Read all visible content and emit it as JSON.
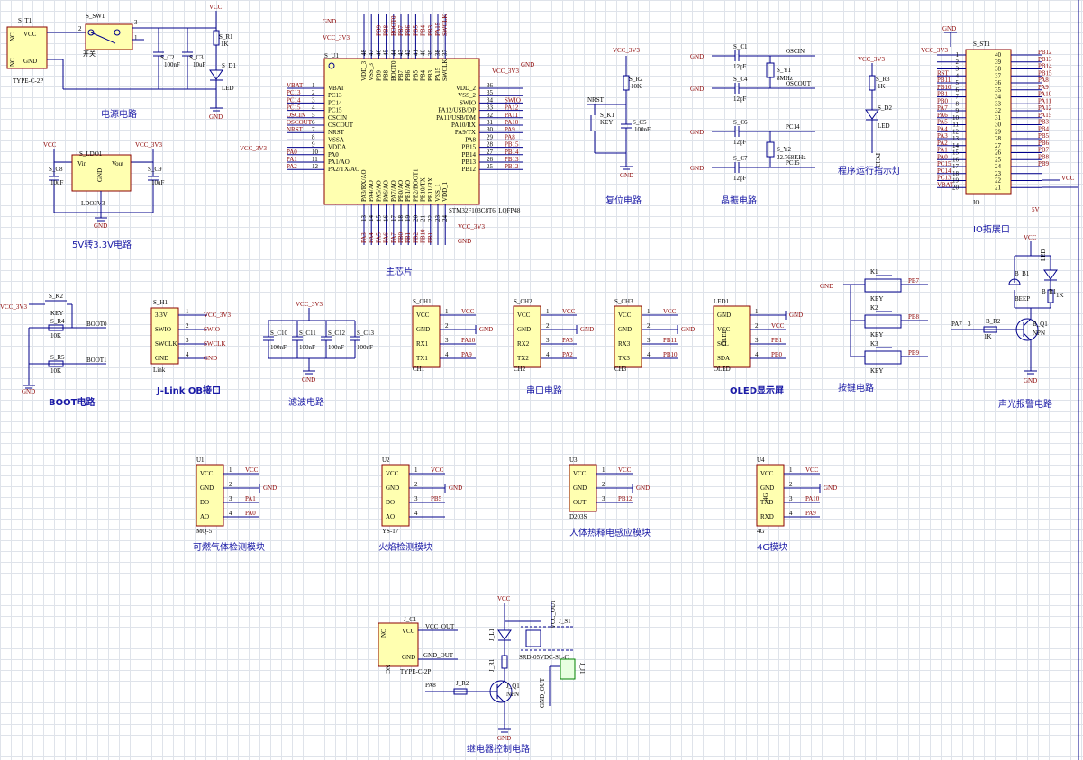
{
  "sections": {
    "power": "电源电路",
    "ldo": "5V转3.3V电路",
    "mcu": "主芯片",
    "reset": "复位电路",
    "crystal": "晶振电路",
    "indicator": "程序运行指示灯",
    "io": "IO拓展口",
    "boot": "BOOT电路",
    "jlink": "J-Link OB接口",
    "filter": "滤波电路",
    "uart": "串口电路",
    "oled": "OLED显示屏",
    "keys": "按键电路",
    "alarm": "声光报警电路",
    "gas": "可燃气体检测模块",
    "flame": "火焰检测模块",
    "pir": "人体热释电感应模块",
    "m4g": "4G模块",
    "relay": "继电器控制电路"
  },
  "power": {
    "usb_ref": "S_T1",
    "usb_name": "TYPE-C-2P",
    "nc": "NC",
    "vcc": "VCC",
    "gnd": "GND",
    "sw_ref": "S_SW1",
    "sw_name": "开关",
    "c2": "S_C2",
    "c2v": "100nF",
    "c3": "S_C3",
    "c3v": "10uF",
    "r1": "S_R1",
    "r1v": "1K",
    "d1": "S_D1",
    "led": "LED",
    "vcc_net": "VCC",
    "gnd_net": "GND",
    "p1": "1",
    "p2": "2",
    "p3": "3"
  },
  "ldo": {
    "ref": "S_LDO1",
    "vin": "Vin",
    "vout": "Vout",
    "gnd": "GND",
    "name": "LDO3V3",
    "c8": "S_C8",
    "c9": "S_C9",
    "cv": "10uF",
    "vcc": "VCC",
    "vcc33": "VCC_3V3",
    "gnd_net": "GND"
  },
  "mcu": {
    "ref": "S_U1",
    "part": "STM32F103C8T6_LQFP48",
    "left_pins": [
      {
        "num": "1",
        "name": "VBAT",
        "net": "VBAT"
      },
      {
        "num": "2",
        "name": "PC13",
        "net": "PC13"
      },
      {
        "num": "3",
        "name": "PC14",
        "net": "PC14"
      },
      {
        "num": "4",
        "name": "PC15",
        "net": "PC15"
      },
      {
        "num": "5",
        "name": "OSCIN",
        "net": "OSCIN"
      },
      {
        "num": "6",
        "name": "OSCOUT",
        "net": "OSCOUT"
      },
      {
        "num": "7",
        "name": "NRST",
        "net": "NRST"
      },
      {
        "num": "8",
        "name": "VSSA",
        "net": "GND"
      },
      {
        "num": "9",
        "name": "VDDA",
        "net": "VCC_3V3"
      },
      {
        "num": "10",
        "name": "PA0",
        "net": "PA0"
      },
      {
        "num": "11",
        "name": "PA1/AO",
        "net": "PA1"
      },
      {
        "num": "12",
        "name": "PA2/TX/AO",
        "net": "PA2"
      }
    ],
    "right_pins": [
      {
        "num": "36",
        "name": "VDD_2",
        "net": ""
      },
      {
        "num": "35",
        "name": "VSS_2",
        "net": ""
      },
      {
        "num": "34",
        "name": "SWIO",
        "net": "SWIO"
      },
      {
        "num": "33",
        "name": "PA12/USB/DP",
        "net": "PA12"
      },
      {
        "num": "32",
        "name": "PA11/USB/DM",
        "net": "PA11"
      },
      {
        "num": "31",
        "name": "PA10/RX",
        "net": "PA10"
      },
      {
        "num": "30",
        "name": "PA9/TX",
        "net": "PA9"
      },
      {
        "num": "29",
        "name": "PA8",
        "net": "PA8"
      },
      {
        "num": "28",
        "name": "PB15",
        "net": "PB15"
      },
      {
        "num": "27",
        "name": "PB14",
        "net": "PB14"
      },
      {
        "num": "26",
        "name": "PB13",
        "net": "PB13"
      },
      {
        "num": "25",
        "name": "PB12",
        "net": "PB12"
      }
    ],
    "top_pins": [
      {
        "num": "48",
        "name": "VDD_3"
      },
      {
        "num": "47",
        "name": "VSS_3"
      },
      {
        "num": "46",
        "name": "PB9"
      },
      {
        "num": "45",
        "name": "PB8"
      },
      {
        "num": "44",
        "name": "BOOT0"
      },
      {
        "num": "43",
        "name": "PB7"
      },
      {
        "num": "42",
        "name": "PB6"
      },
      {
        "num": "41",
        "name": "PB5"
      },
      {
        "num": "40",
        "name": "PB4"
      },
      {
        "num": "39",
        "name": "PB3"
      },
      {
        "num": "38",
        "name": "PA15"
      },
      {
        "num": "37",
        "name": "SWCLK"
      }
    ],
    "bottom_pins": [
      {
        "num": "13",
        "name": "PA3/RX/AO"
      },
      {
        "num": "14",
        "name": "PA4/AO"
      },
      {
        "num": "15",
        "name": "PA5/AO"
      },
      {
        "num": "16",
        "name": "PA6/AO"
      },
      {
        "num": "17",
        "name": "PA7/AO"
      },
      {
        "num": "18",
        "name": "PB0/AO"
      },
      {
        "num": "19",
        "name": "PB1/AO"
      },
      {
        "num": "20",
        "name": "PB2/BOOT1"
      },
      {
        "num": "21",
        "name": "PB10/TX"
      },
      {
        "num": "22",
        "name": "PB11/RX"
      },
      {
        "num": "23",
        "name": "VSS_1"
      },
      {
        "num": "24",
        "name": "VDD_1"
      }
    ],
    "top_nets": [
      "",
      "",
      "PB9",
      "PB8",
      "BOOT0",
      "PB7",
      "PB6",
      "PB5",
      "PB4",
      "PB3",
      "PA15",
      "SWCLK"
    ],
    "bottom_nets": [
      "PA3",
      "PA4",
      "PA5",
      "PA6",
      "PA7",
      "PB0",
      "PB1",
      "PB2",
      "PB10",
      "PB11",
      "",
      ""
    ],
    "gnd": "GND",
    "vcc33": "VCC_3V3"
  },
  "reset": {
    "vcc33": "VCC_3V3",
    "r2": "S_R2",
    "r2v": "10K",
    "nrst": "NRST",
    "k1": "S_K1",
    "key": "KEY",
    "c5": "S_C5",
    "c5v": "100nF",
    "gnd": "GND"
  },
  "crystal": {
    "c1": "S_C1",
    "c4": "S_C4",
    "c6": "S_C6",
    "c7": "S_C7",
    "cv": "12pF",
    "y1": "S_Y1",
    "y1f": "8MHz",
    "y2": "S_Y2",
    "y2f": "32.768KHz",
    "oscin": "OSCIN",
    "oscout": "OSCOUT",
    "pc14": "PC14",
    "pc15": "PC15",
    "gnd": "GND"
  },
  "indicator": {
    "vcc33": "VCC_3V3",
    "r3": "S_R3",
    "r3v": "1K",
    "d2": "S_D2",
    "led": "LED",
    "net": "PC13"
  },
  "io": {
    "ref": "S_ST1",
    "name": "IO",
    "gnd": "GND",
    "vcc33": "VCC_3V3",
    "vcc": "VCC",
    "v5": "5V",
    "left": [
      {
        "net": "",
        "num": "1"
      },
      {
        "net": "",
        "num": "2"
      },
      {
        "net": "",
        "num": "3"
      },
      {
        "net": "RST",
        "num": "4"
      },
      {
        "net": "PB11",
        "num": "5"
      },
      {
        "net": "PB10",
        "num": "6"
      },
      {
        "net": "PB1",
        "num": "7"
      },
      {
        "net": "PB0",
        "num": "8"
      },
      {
        "net": "PA7",
        "num": "9"
      },
      {
        "net": "PA6",
        "num": "10"
      },
      {
        "net": "PA5",
        "num": "11"
      },
      {
        "net": "PA4",
        "num": "12"
      },
      {
        "net": "PA3",
        "num": "13"
      },
      {
        "net": "PA2",
        "num": "14"
      },
      {
        "net": "PA1",
        "num": "15"
      },
      {
        "net": "PA0",
        "num": "16"
      },
      {
        "net": "PC15",
        "num": "17"
      },
      {
        "net": "PC14",
        "num": "18"
      },
      {
        "net": "PC13",
        "num": "19"
      },
      {
        "net": "VBAT",
        "num": "20"
      }
    ],
    "right": [
      {
        "num": "40",
        "net": "PB12"
      },
      {
        "num": "39",
        "net": "PB13"
      },
      {
        "num": "38",
        "net": "PB14"
      },
      {
        "num": "37",
        "net": "PB15"
      },
      {
        "num": "36",
        "net": "PA8"
      },
      {
        "num": "35",
        "net": "PA9"
      },
      {
        "num": "34",
        "net": "PA10"
      },
      {
        "num": "33",
        "net": "PA11"
      },
      {
        "num": "32",
        "net": "PA12"
      },
      {
        "num": "31",
        "net": "PA15"
      },
      {
        "num": "30",
        "net": "PB3"
      },
      {
        "num": "29",
        "net": "PB4"
      },
      {
        "num": "28",
        "net": "PB5"
      },
      {
        "num": "27",
        "net": "PB6"
      },
      {
        "num": "26",
        "net": "PB7"
      },
      {
        "num": "25",
        "net": "PB8"
      },
      {
        "num": "24",
        "net": "PB9"
      },
      {
        "num": "23",
        "net": ""
      },
      {
        "num": "22",
        "net": ""
      },
      {
        "num": "21",
        "net": ""
      }
    ]
  },
  "boot": {
    "vcc33": "VCC_3V3",
    "k2": "S_K2",
    "key": "KEY",
    "r4": "S_R4",
    "r5": "S_R5",
    "rv": "10K",
    "boot0": "BOOT0",
    "boot1": "BOOT1",
    "gnd": "GND"
  },
  "jlink": {
    "ref": "S_H1",
    "name": "Link",
    "pins": [
      {
        "num": "1",
        "name": "3.3V",
        "net": "VCC_3V3"
      },
      {
        "num": "2",
        "name": "SWIO",
        "net": "SWIO"
      },
      {
        "num": "3",
        "name": "SWCLK",
        "net": "SWCLK"
      },
      {
        "num": "4",
        "name": "GND",
        "net": "GND"
      }
    ]
  },
  "filter": {
    "vcc33": "VCC_3V3",
    "caps": [
      "S_C10",
      "S_C11",
      "S_C12",
      "S_C13"
    ],
    "cv": "100nF",
    "gnd": "GND"
  },
  "uart": [
    {
      "ref": "S_CH1",
      "name": "CH1",
      "pins": [
        {
          "num": "1",
          "name": "VCC",
          "net": "VCC"
        },
        {
          "num": "2",
          "name": "GND",
          "net": "GND"
        },
        {
          "num": "3",
          "name": "RX1",
          "net": "PA10"
        },
        {
          "num": "4",
          "name": "TX1",
          "net": "PA9"
        }
      ]
    },
    {
      "ref": "S_CH2",
      "name": "CH2",
      "pins": [
        {
          "num": "1",
          "name": "VCC",
          "net": "VCC"
        },
        {
          "num": "2",
          "name": "GND",
          "net": "GND"
        },
        {
          "num": "3",
          "name": "RX2",
          "net": "PA3"
        },
        {
          "num": "4",
          "name": "TX2",
          "net": "PA2"
        }
      ]
    },
    {
      "ref": "S_CH3",
      "name": "CH3",
      "pins": [
        {
          "num": "1",
          "name": "VCC",
          "net": "VCC"
        },
        {
          "num": "2",
          "name": "GND",
          "net": "GND"
        },
        {
          "num": "3",
          "name": "RX3",
          "net": "PB11"
        },
        {
          "num": "4",
          "name": "TX3",
          "net": "PB10"
        }
      ]
    }
  ],
  "oled": {
    "ref": "LED1",
    "name": "OLED",
    "side": "OLED",
    "pins": [
      {
        "num": "1",
        "name": "GND",
        "net": "GND"
      },
      {
        "num": "2",
        "name": "VCC",
        "net": "VCC"
      },
      {
        "num": "3",
        "name": "SCL",
        "net": "PB1"
      },
      {
        "num": "4",
        "name": "SDA",
        "net": "PB0"
      }
    ]
  },
  "keys": {
    "gnd": "GND",
    "items": [
      {
        "ref": "K1",
        "name": "KEY",
        "net": "PB7"
      },
      {
        "ref": "K2",
        "name": "KEY",
        "net": "PB8"
      },
      {
        "ref": "K3",
        "name": "KEY",
        "net": "PB9"
      }
    ]
  },
  "alarm": {
    "vcc": "VCC",
    "b1": "B_B1",
    "beep": "BEEP",
    "b_r1": "B_R1",
    "r1v": "1K",
    "led": "LED",
    "pa7": "PA7",
    "r2": "B_R2",
    "r2v": "1K",
    "q1": "B_Q1",
    "npn": "NPN",
    "gnd": "GND",
    "p3": "3"
  },
  "modules": [
    {
      "ref": "U1",
      "name": "MQ-5",
      "pins": [
        {
          "num": "1",
          "name": "VCC",
          "net": "VCC"
        },
        {
          "num": "2",
          "name": "GND",
          "net": "GND"
        },
        {
          "num": "3",
          "name": "DO",
          "net": "PA1"
        },
        {
          "num": "4",
          "name": "AO",
          "net": "PA0"
        }
      ]
    },
    {
      "ref": "U2",
      "name": "YS-17",
      "pins": [
        {
          "num": "1",
          "name": "VCC",
          "net": "VCC"
        },
        {
          "num": "2",
          "name": "GND",
          "net": "GND"
        },
        {
          "num": "3",
          "name": "DO",
          "net": "PB5"
        },
        {
          "num": "4",
          "name": "AO",
          "net": ""
        }
      ]
    },
    {
      "ref": "U3",
      "name": "D203S",
      "pins": [
        {
          "num": "1",
          "name": "VCC",
          "net": "VCC"
        },
        {
          "num": "2",
          "name": "GND",
          "net": "GND"
        },
        {
          "num": "3",
          "name": "OUT",
          "net": "PB12"
        }
      ]
    },
    {
      "ref": "U4",
      "name": "4G",
      "side": "4G",
      "pins": [
        {
          "num": "1",
          "name": "VCC",
          "net": "VCC"
        },
        {
          "num": "2",
          "name": "GND",
          "net": "GND"
        },
        {
          "num": "3",
          "name": "TXD",
          "net": "PA10"
        },
        {
          "num": "4",
          "name": "RXD",
          "net": "PA9"
        }
      ]
    }
  ],
  "relay": {
    "jc1": "J_C1",
    "usb": "TYPE-C-2P",
    "nc": "NC",
    "vcc": "VCC",
    "gnd": "GND",
    "vcc_out": "VCC_OUT",
    "gnd_out": "GND_OUT",
    "vccnet": "VCC",
    "l1": "J_L1",
    "s1": "J_S1",
    "relay": "SRD-05VDC-SL-C",
    "r1": "J_R1",
    "pa8": "PA8",
    "r2": "J_R2",
    "q1": "J_Q1",
    "npn": "NPN",
    "j1": "J_J1",
    "gndnet": "GND"
  }
}
